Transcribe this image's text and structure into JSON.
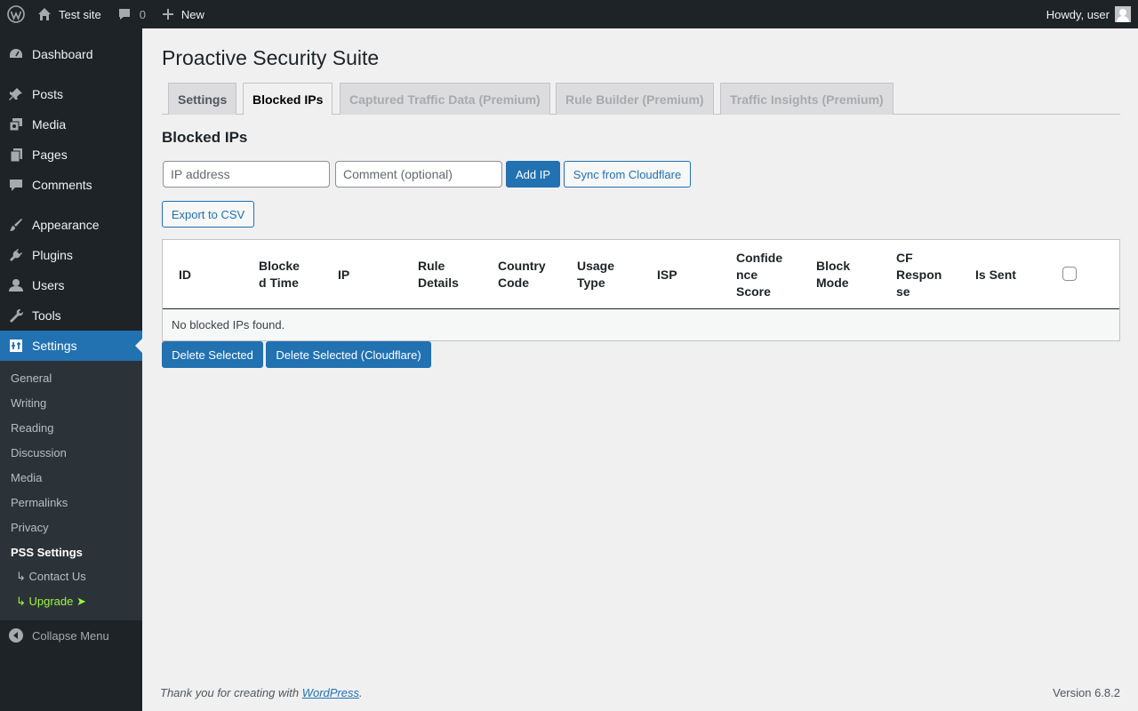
{
  "adminbar": {
    "site_name": "Test site",
    "comments_count": "0",
    "new_label": "New",
    "howdy": "Howdy, user"
  },
  "sidebar": {
    "items": [
      {
        "label": "Dashboard",
        "icon": "dashboard-icon"
      },
      {
        "label": "Posts",
        "icon": "pin-icon"
      },
      {
        "label": "Media",
        "icon": "media-icon"
      },
      {
        "label": "Pages",
        "icon": "pages-icon"
      },
      {
        "label": "Comments",
        "icon": "comment-icon"
      },
      {
        "label": "Appearance",
        "icon": "brush-icon"
      },
      {
        "label": "Plugins",
        "icon": "plug-icon"
      },
      {
        "label": "Users",
        "icon": "user-icon"
      },
      {
        "label": "Tools",
        "icon": "wrench-icon"
      },
      {
        "label": "Settings",
        "icon": "settings-icon",
        "active": true
      }
    ],
    "submenu": [
      "General",
      "Writing",
      "Reading",
      "Discussion",
      "Media",
      "Permalinks",
      "Privacy",
      "PSS Settings",
      "↳ Contact Us",
      "↳ Upgrade ➤"
    ],
    "collapse_label": "Collapse Menu"
  },
  "page": {
    "title": "Proactive Security Suite",
    "tabs": [
      "Settings",
      "Blocked IPs",
      "Captured Traffic Data (Premium)",
      "Rule Builder (Premium)",
      "Traffic Insights (Premium)"
    ],
    "active_tab": "Blocked IPs",
    "section_title": "Blocked IPs",
    "ip_placeholder": "IP address",
    "comment_placeholder": "Comment (optional)",
    "add_ip_label": "Add IP",
    "sync_label": "Sync from Cloudflare",
    "export_label": "Export to CSV",
    "columns": [
      "ID",
      "Blocke d Time",
      "IP",
      "Rule Details",
      "Country Code",
      "Usage Type",
      "ISP",
      "Confide nce Score",
      "Block Mode",
      "CF Respon se",
      "Is Sent"
    ],
    "empty_message": "No blocked IPs found.",
    "delete_selected_label": "Delete Selected",
    "delete_cf_label": "Delete Selected (Cloudflare)"
  },
  "footer": {
    "thanks_prefix": "Thank you for creating with ",
    "wordpress_link": "WordPress",
    "thanks_suffix": ".",
    "version": "Version 6.8.2"
  },
  "colors": {
    "admin_bg": "#1d2327",
    "accent": "#2271b1",
    "upgrade": "#9bf53a"
  }
}
